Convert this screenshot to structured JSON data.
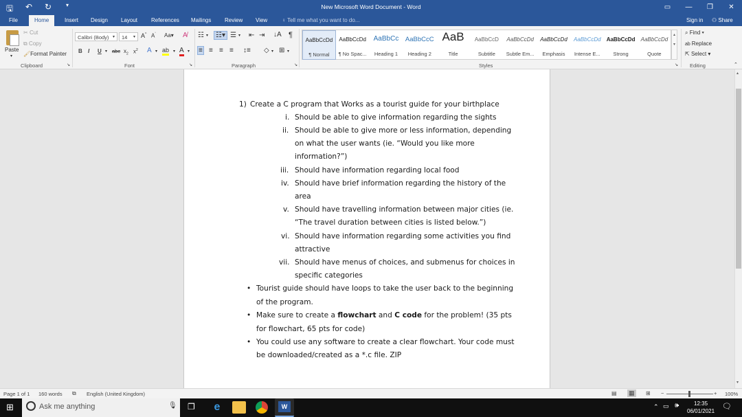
{
  "window": {
    "title": "New Microsoft Word Document - Word"
  },
  "qat_icons": [
    "save-icon",
    "undo-icon",
    "redo-icon",
    "customize-qat-icon"
  ],
  "tabs": [
    "File",
    "Home",
    "Insert",
    "Design",
    "Layout",
    "References",
    "Mailings",
    "Review",
    "View"
  ],
  "tell_me": "Tell me what you want to do...",
  "sign_in": "Sign in",
  "share": "Share",
  "ribbon": {
    "paste": "Paste",
    "cut": "Cut",
    "copy": "Copy",
    "format_painter": "Format Painter",
    "clipboard": "Clipboard",
    "font_name": "Calibri (Body)",
    "font_size": "14",
    "font": "Font",
    "paragraph": "Paragraph",
    "styles": "Styles",
    "editing": "Editing",
    "find": "Find",
    "replace": "Replace",
    "select": "Select",
    "style_items": [
      {
        "sample": "AaBbCcDd",
        "name": "¶ Normal"
      },
      {
        "sample": "AaBbCcDd",
        "name": "¶ No Spac..."
      },
      {
        "sample": "AaBbCc",
        "name": "Heading 1"
      },
      {
        "sample": "AaBbCcC",
        "name": "Heading 2"
      },
      {
        "sample": "AaB",
        "name": "Title"
      },
      {
        "sample": "AaBbCcD",
        "name": "Subtitle"
      },
      {
        "sample": "AaBbCcDd",
        "name": "Subtle Em..."
      },
      {
        "sample": "AaBbCcDd",
        "name": "Emphasis"
      },
      {
        "sample": "AaBbCcDd",
        "name": "Intense E..."
      },
      {
        "sample": "AaBbCcDd",
        "name": "Strong"
      },
      {
        "sample": "AaBbCcDd",
        "name": "Quote"
      }
    ]
  },
  "document": {
    "heading_num": "1)",
    "heading": "Create a C program that Works as a tourist guide for your birthplace",
    "sub_items": [
      {
        "num": "i.",
        "lines": [
          "Should be able to give information regarding the sights"
        ]
      },
      {
        "num": "ii.",
        "lines": [
          "Should be able to give more or less information, depending",
          "on what the user wants (ie. “Would you like more",
          "information?”)"
        ]
      },
      {
        "num": "iii.",
        "lines": [
          "Should have information regarding local food"
        ]
      },
      {
        "num": "iv.",
        "lines": [
          "Should have brief information regarding the history of the",
          "area"
        ]
      },
      {
        "num": "v.",
        "lines": [
          "Should have travelling information between major cities (ie.",
          "“The travel duration between cities is listed below.”)"
        ]
      },
      {
        "num": "vi.",
        "lines": [
          "Should have information regarding some activities you find",
          "attractive"
        ]
      },
      {
        "num": "vii.",
        "lines": [
          "Should have menus of choices, and submenus for choices in",
          "specific categories"
        ]
      }
    ],
    "bullet1": [
      "Tourist guide should have loops to take the user back to the beginning",
      "of the program."
    ],
    "bullet2_a": "Make sure to create a ",
    "bullet2_b": "flowchart",
    "bullet2_c": " and ",
    "bullet2_d": "C code",
    "bullet2_e": " for the problem! (35 pts",
    "bullet2_line2": "for flowchart, 65 pts for code)",
    "bullet3": [
      "You could use any software to create a clear flowchart. Your code must",
      "be downloaded/created as a *.c file. ZIP"
    ]
  },
  "status": {
    "page": "Page 1 of 1",
    "words": "160 words",
    "language": "English (United Kingdom)",
    "zoom": "100%",
    "zoom_level": 1.0
  },
  "taskbar": {
    "search": "Ask me anything",
    "time": "12:35",
    "date": "06/01/2021"
  }
}
